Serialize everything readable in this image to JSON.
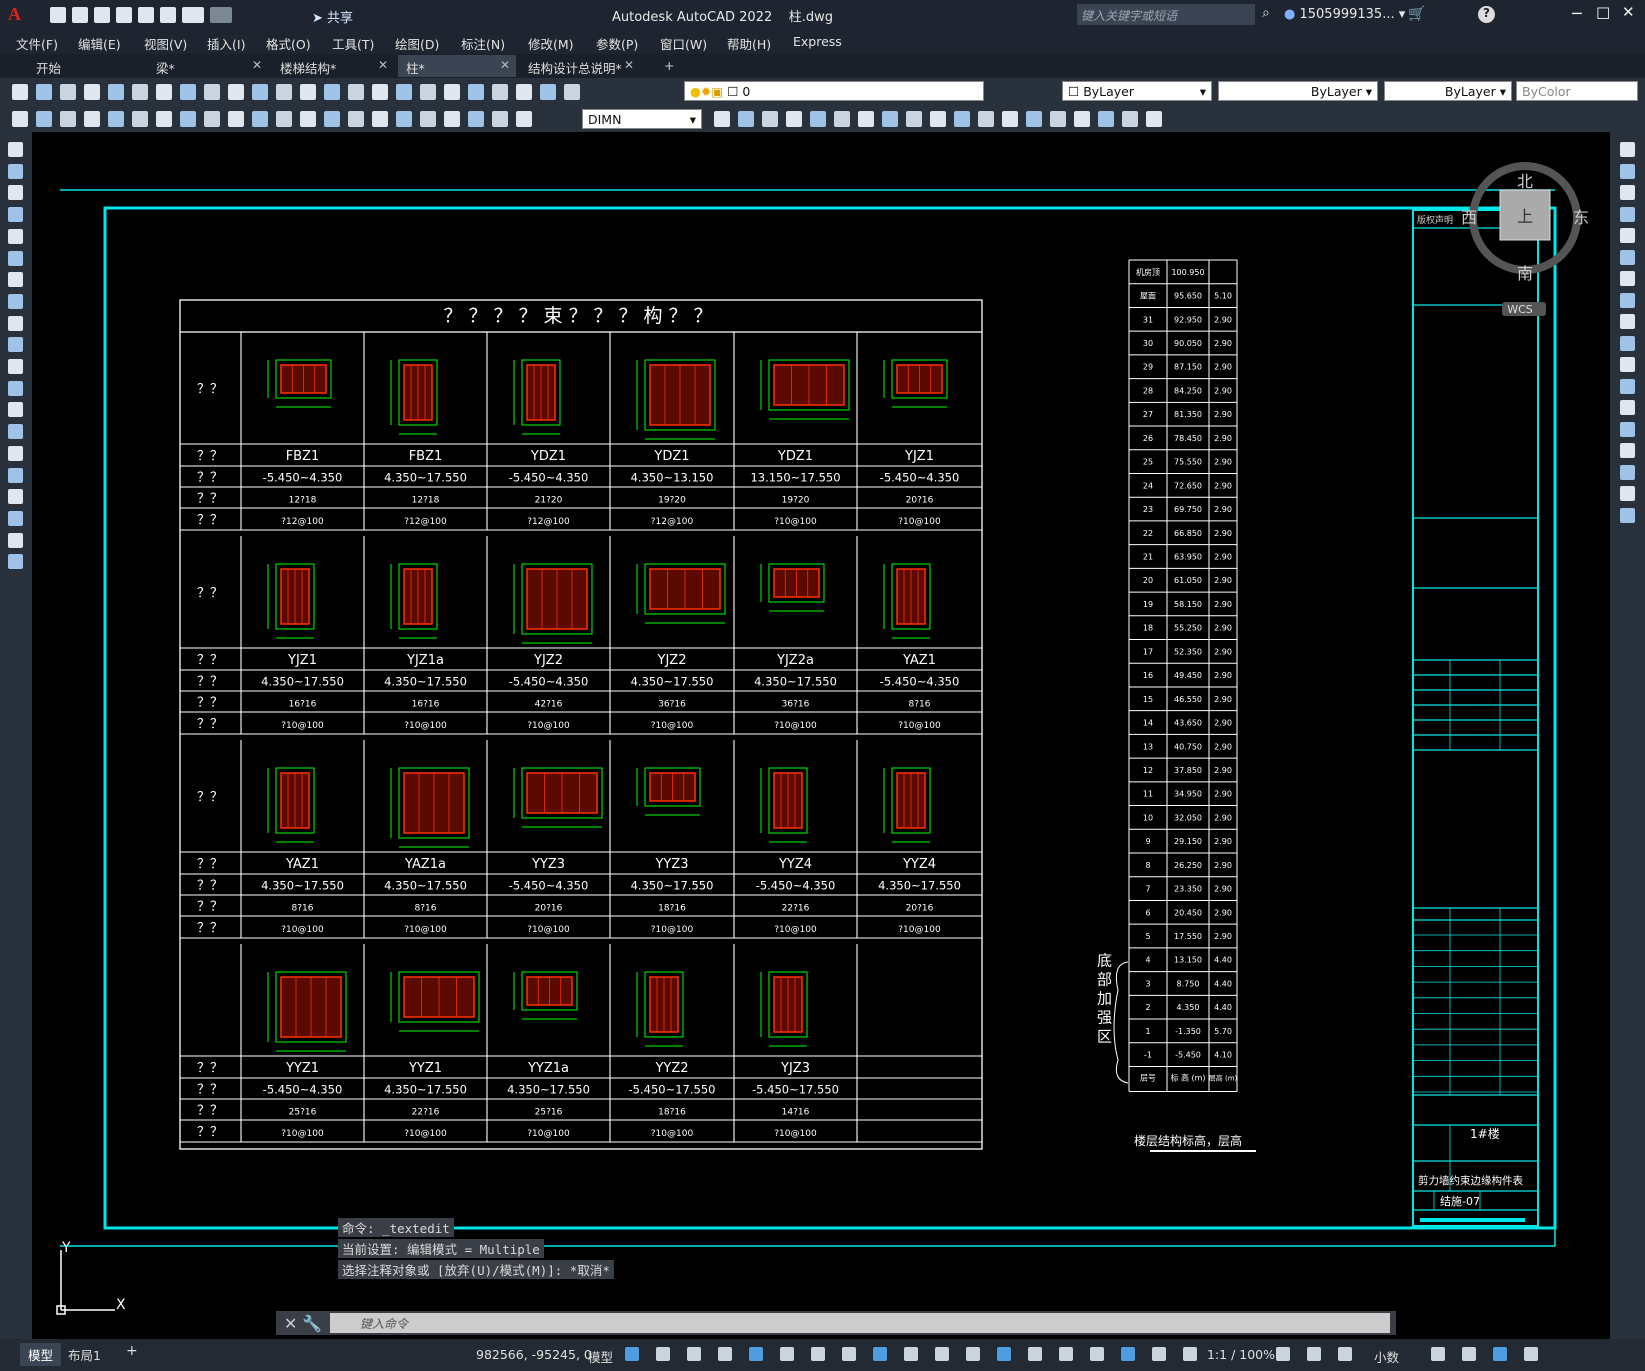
{
  "title_bar": {
    "app_title": "Autodesk AutoCAD 2022",
    "file": "柱.dwg",
    "search_placeholder": "键入关键字或短语",
    "user": "1505999135...",
    "share": "共享"
  },
  "menus": [
    "文件(F)",
    "编辑(E)",
    "视图(V)",
    "插入(I)",
    "格式(O)",
    "工具(T)",
    "绘图(D)",
    "标注(N)",
    "修改(M)",
    "参数(P)",
    "窗口(W)",
    "帮助(H)",
    "Express"
  ],
  "tabs": [
    {
      "label": "开始"
    },
    {
      "label": "梁*"
    },
    {
      "label": "楼梯结构*"
    },
    {
      "label": "柱*",
      "active": true
    },
    {
      "label": "结构设计总说明*"
    }
  ],
  "toolbar": {
    "layer": "0",
    "color": "ByLayer",
    "linetype": "ByLayer",
    "lineweight": "ByLayer",
    "plotstyle": "ByColor",
    "dimstyle": "DIMN"
  },
  "viewcube": {
    "north": "北",
    "south": "南",
    "east": "东",
    "west": "西",
    "top": "上",
    "wcs": "WCS"
  },
  "table_title": "？？？？束？？？构？？",
  "row_label": "？？",
  "groups": [
    {
      "names": [
        "FBZ1",
        "FBZ1",
        "YDZ1",
        "YDZ1",
        "YDZ1",
        "YJZ1"
      ],
      "elev": [
        "-5.450~4.350",
        "4.350~17.550",
        "-5.450~4.350",
        "4.350~13.150",
        "13.150~17.550",
        "-5.450~4.350"
      ],
      "long": [
        "12?18",
        "12?18",
        "21?20",
        "19?20",
        "19?20",
        "20?16"
      ],
      "stirrup": [
        "?12@100",
        "?12@100",
        "?12@100",
        "?12@100",
        "?10@100",
        "?10@100"
      ]
    },
    {
      "names": [
        "YJZ1",
        "YJZ1a",
        "YJZ2",
        "YJZ2",
        "YJZ2a",
        "YAZ1"
      ],
      "elev": [
        "4.350~17.550",
        "4.350~17.550",
        "-5.450~4.350",
        "4.350~17.550",
        "4.350~17.550",
        "-5.450~4.350"
      ],
      "long": [
        "16?16",
        "16?16",
        "42?16",
        "36?16",
        "36?16",
        "8?16"
      ],
      "stirrup": [
        "?10@100",
        "?10@100",
        "?10@100",
        "?10@100",
        "?10@100",
        "?10@100"
      ]
    },
    {
      "names": [
        "YAZ1",
        "YAZ1a",
        "YYZ3",
        "YYZ3",
        "YYZ4",
        "YYZ4"
      ],
      "elev": [
        "4.350~17.550",
        "4.350~17.550",
        "-5.450~4.350",
        "4.350~17.550",
        "-5.450~4.350",
        "4.350~17.550"
      ],
      "long": [
        "8?16",
        "8?16",
        "20?16",
        "18?16",
        "22?16",
        "20?16"
      ],
      "stirrup": [
        "?10@100",
        "?10@100",
        "?10@100",
        "?10@100",
        "?10@100",
        "?10@100"
      ]
    },
    {
      "names": [
        "YYZ1",
        "YYZ1",
        "YYZ1a",
        "YYZ2",
        "YJZ3",
        ""
      ],
      "elev": [
        "-5.450~4.350",
        "4.350~17.550",
        "4.350~17.550",
        "-5.450~17.550",
        "-5.450~17.550",
        ""
      ],
      "long": [
        "25?16",
        "22?16",
        "25?16",
        "18?16",
        "14?16",
        ""
      ],
      "stirrup": [
        "?10@100",
        "?10@100",
        "?10@100",
        "?10@100",
        "?10@100",
        ""
      ]
    }
  ],
  "floors": [
    {
      "f": "机房顶",
      "e": "100.950",
      "h": ""
    },
    {
      "f": "屋面",
      "e": "95.650",
      "h": "5.10"
    },
    {
      "f": "31",
      "e": "92.950",
      "h": "2.90"
    },
    {
      "f": "30",
      "e": "90.050",
      "h": "2.90"
    },
    {
      "f": "29",
      "e": "87.150",
      "h": "2.90"
    },
    {
      "f": "28",
      "e": "84.250",
      "h": "2.90"
    },
    {
      "f": "27",
      "e": "81.350",
      "h": "2.90"
    },
    {
      "f": "26",
      "e": "78.450",
      "h": "2.90"
    },
    {
      "f": "25",
      "e": "75.550",
      "h": "2.90"
    },
    {
      "f": "24",
      "e": "72.650",
      "h": "2.90"
    },
    {
      "f": "23",
      "e": "69.750",
      "h": "2.90"
    },
    {
      "f": "22",
      "e": "66.850",
      "h": "2.90"
    },
    {
      "f": "21",
      "e": "63.950",
      "h": "2.90"
    },
    {
      "f": "20",
      "e": "61.050",
      "h": "2.90"
    },
    {
      "f": "19",
      "e": "58.150",
      "h": "2.90"
    },
    {
      "f": "18",
      "e": "55.250",
      "h": "2.90"
    },
    {
      "f": "17",
      "e": "52.350",
      "h": "2.90"
    },
    {
      "f": "16",
      "e": "49.450",
      "h": "2.90"
    },
    {
      "f": "15",
      "e": "46.550",
      "h": "2.90"
    },
    {
      "f": "14",
      "e": "43.650",
      "h": "2.90"
    },
    {
      "f": "13",
      "e": "40.750",
      "h": "2.90"
    },
    {
      "f": "12",
      "e": "37.850",
      "h": "2.90"
    },
    {
      "f": "11",
      "e": "34.950",
      "h": "2.90"
    },
    {
      "f": "10",
      "e": "32.050",
      "h": "2.90"
    },
    {
      "f": "9",
      "e": "29.150",
      "h": "2.90"
    },
    {
      "f": "8",
      "e": "26.250",
      "h": "2.90"
    },
    {
      "f": "7",
      "e": "23.350",
      "h": "2.90"
    },
    {
      "f": "6",
      "e": "20.450",
      "h": "2.90"
    },
    {
      "f": "5",
      "e": "17.550",
      "h": "2.90"
    },
    {
      "f": "4",
      "e": "13.150",
      "h": "4.40"
    },
    {
      "f": "3",
      "e": "8.750",
      "h": "4.40"
    },
    {
      "f": "2",
      "e": "4.350",
      "h": "4.40"
    },
    {
      "f": "1",
      "e": "-1.350",
      "h": "5.70"
    },
    {
      "f": "-1",
      "e": "-5.450",
      "h": "4.10"
    }
  ],
  "floor_header": {
    "f": "层号",
    "e": "标 高 (m)",
    "h": "层高 (m)"
  },
  "floor_title": "楼层结构标高，层高",
  "reinforce_zone": "底部加强区",
  "titleblock": {
    "copyright": "版权声明",
    "building": "1#楼",
    "drawing_title": "剪力墙约束边缘构件表",
    "drawing_no": "结施-07"
  },
  "command": {
    "lines": [
      "命令: _textedit",
      "当前设置: 编辑模式 = Multiple",
      "选择注释对象或 [放弃(U)/模式(M)]: *取消*"
    ],
    "placeholder": "键入命令"
  },
  "status": {
    "coords": "982566, -95245, 0",
    "model": "模型",
    "layout_tabs": [
      "模型",
      "布局1"
    ],
    "scale": "1:1 / 100%",
    "units": "小数"
  }
}
